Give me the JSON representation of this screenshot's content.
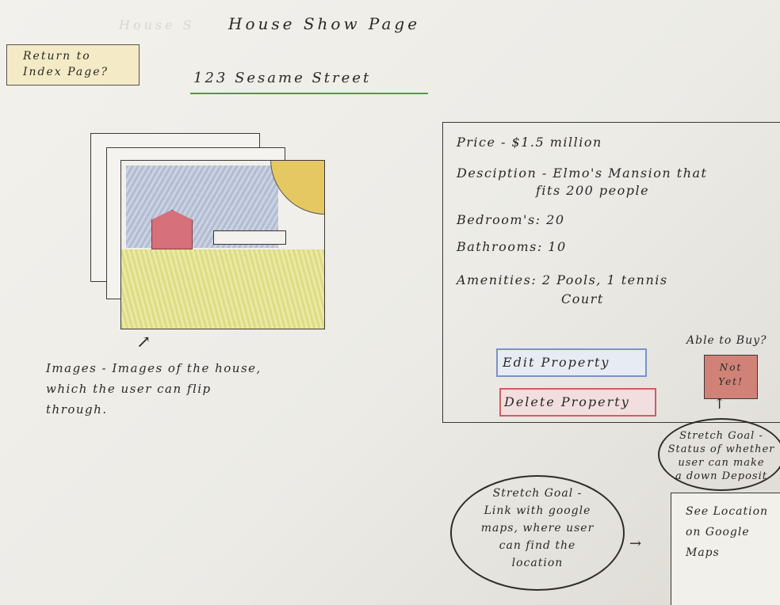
{
  "header": {
    "faded_title": "House S",
    "title": "House  Show  Page"
  },
  "nav": {
    "return_line1": "Return to",
    "return_line2": "Index Page?"
  },
  "property": {
    "address": "123  Sesame Street",
    "price": "Price  -  $1.5 million",
    "description_line1": "Desciption - Elmo's Mansion that",
    "description_line2": "fits 200 people",
    "bedrooms": "Bedroom's:  20",
    "bathrooms": "Bathrooms:  10",
    "amenities_line1": "Amenities:  2 Pools, 1 tennis",
    "amenities_line2": "Court"
  },
  "gallery": {
    "caption_line1": "Images - Images of the house,",
    "caption_line2": "which the user can flip",
    "caption_line3": "through."
  },
  "actions": {
    "edit_label": "Edit Property",
    "delete_label": "Delete Property"
  },
  "purchase": {
    "question": "Able to Buy?",
    "status_line1": "Not",
    "status_line2": "Yet!",
    "note_line1": "Stretch Goal -",
    "note_line2": "Status of whether",
    "note_line3": "user can make",
    "note_line4": "a down Deposit"
  },
  "maps": {
    "note_line1": "Stretch Goal -",
    "note_line2": "Link with google",
    "note_line3": "maps, where user",
    "note_line4": "can find the",
    "note_line5": "location",
    "link_line1": "See Location",
    "link_line2": "on Google",
    "link_line3": "Maps"
  }
}
